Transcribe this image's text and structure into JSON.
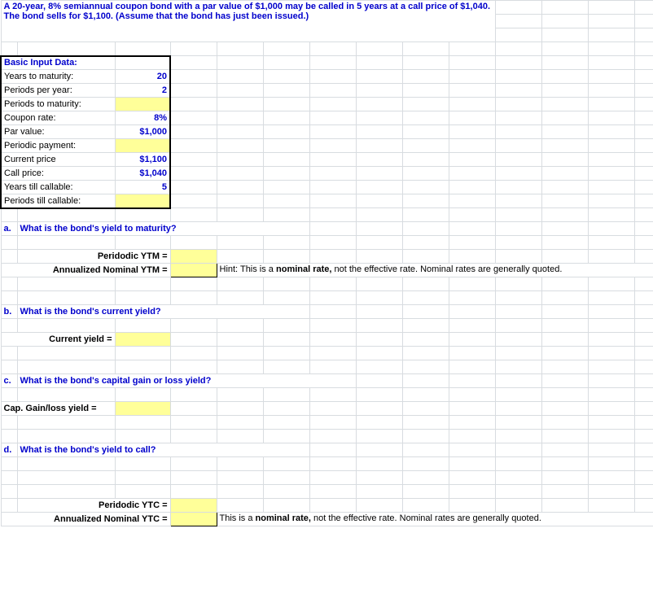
{
  "problem_text": "A 20-year, 8% semiannual coupon bond with a par value of $1,000 may be called in 5 years at a call price of $1,040. The bond sells for $1,100. (Assume that the bond has just been issued.)",
  "input_section": {
    "title": "Basic Input Data:",
    "rows": {
      "years_to_maturity": {
        "label": "Years to maturity:",
        "value": "20"
      },
      "periods_per_year": {
        "label": "Periods per year:",
        "value": "2"
      },
      "periods_to_maturity": {
        "label": "Periods to maturity:",
        "value": ""
      },
      "coupon_rate": {
        "label": "Coupon rate:",
        "value": "8%"
      },
      "par_value": {
        "label": "Par value:",
        "value": "$1,000"
      },
      "periodic_payment": {
        "label": "Periodic payment:",
        "value": ""
      },
      "current_price": {
        "label": "Current price",
        "value": "$1,100"
      },
      "call_price": {
        "label": "Call price:",
        "value": "$1,040"
      },
      "years_till_callable": {
        "label": "Years till callable:",
        "value": "5"
      },
      "periods_till_callable": {
        "label": "Periods till callable:",
        "value": ""
      }
    }
  },
  "qa": {
    "letter": "a.",
    "question": "What is the bond's yield to maturity?",
    "periodic_label": "Peridodic YTM =",
    "annual_label": "Annualized Nominal YTM  =",
    "hint_prefix": "Hint: This is a ",
    "hint_bold": "nominal rate,",
    "hint_suffix": " not the effective rate.  Nominal rates are generally quoted."
  },
  "qb": {
    "letter": "b.",
    "question": "What is the bond's current yield?",
    "label": "Current yield   ="
  },
  "qc": {
    "letter": "c.",
    "question": "What is the bond's capital gain or loss yield?",
    "label": "Cap. Gain/loss yield ="
  },
  "qd": {
    "letter": "d.",
    "question": "What is the bond's yield to call?",
    "periodic_label": "Peridodic YTC =",
    "annual_label": "Annualized Nominal YTC  =",
    "hint_prefix": "This is a ",
    "hint_bold": "nominal rate,",
    "hint_suffix": " not the effective rate.  Nominal rates are generally quoted."
  }
}
